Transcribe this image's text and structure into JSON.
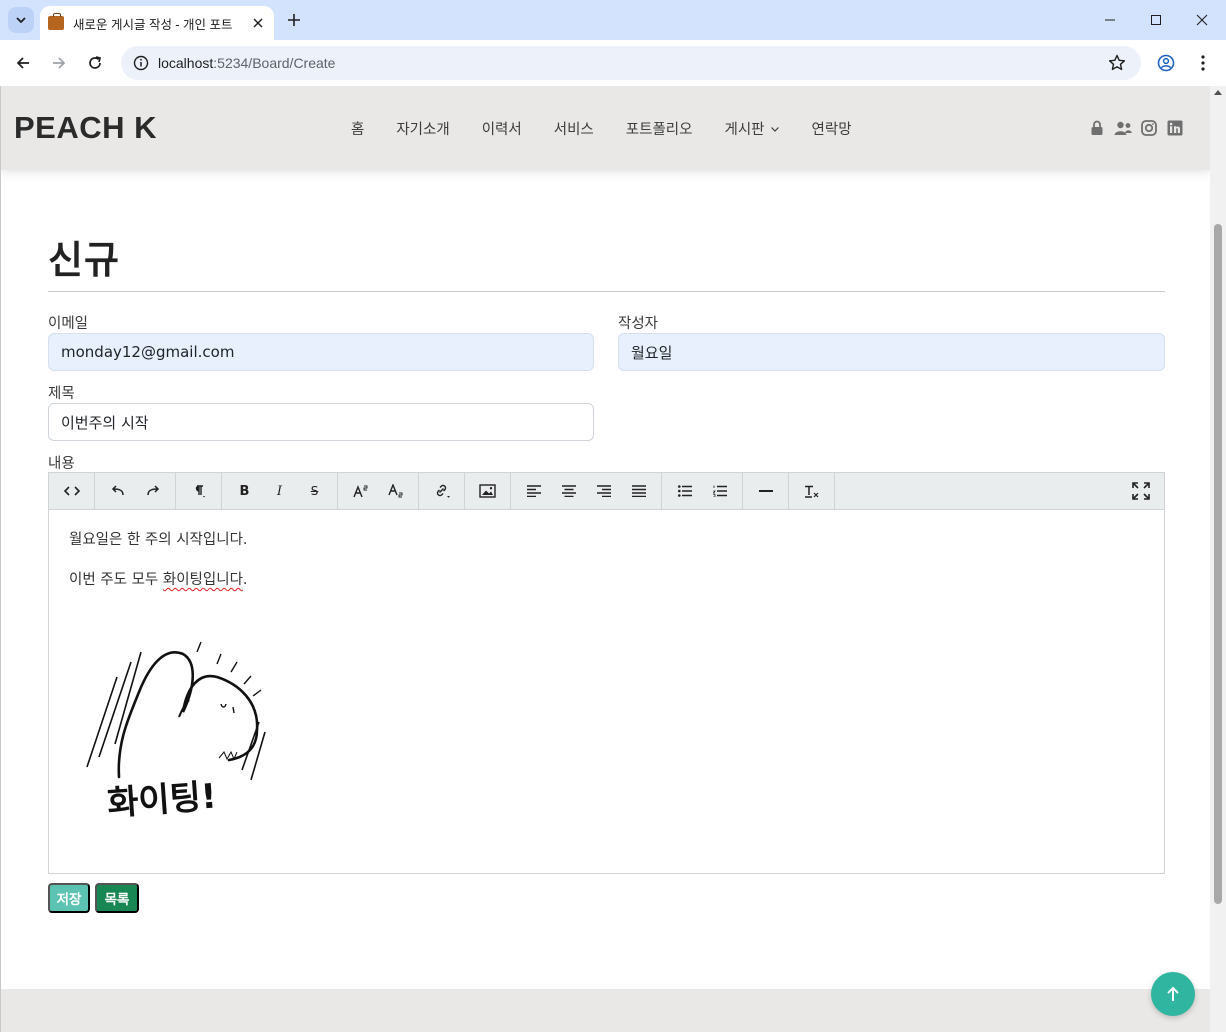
{
  "browser": {
    "tab_title": "새로운 게시글 작성 - 개인 포트",
    "url_host": "localhost",
    "url_rest": ":5234/Board/Create"
  },
  "site": {
    "logo": "PEACH K",
    "menu": [
      "홈",
      "자기소개",
      "이력서",
      "서비스",
      "포트폴리오",
      "게시판",
      "연락망"
    ],
    "social_icons": [
      "lock-icon",
      "user-plus-icon",
      "instagram-icon",
      "linkedin-icon"
    ]
  },
  "page": {
    "title": "신규"
  },
  "form": {
    "email_label": "이메일",
    "email_value": "monday12@gmail.com",
    "author_label": "작성자",
    "author_value": "월요일",
    "subject_label": "제목",
    "subject_value": "이번주의 시작",
    "content_label": "내용"
  },
  "editor": {
    "paragraph1": "월요일은 한 주의 시작입니다.",
    "paragraph2_prefix": "이번 주도 모두 ",
    "paragraph2_misspelled": "화이팅입니다",
    "paragraph2_suffix": ".",
    "sticker_text": "화이팅!"
  },
  "buttons": {
    "save": "저장",
    "list": "목록"
  },
  "colors": {
    "save_button": "#5cc2b1",
    "list_button": "#198754",
    "to_top_button": "#2fb5a0",
    "header_bg": "#e9e8e6"
  }
}
